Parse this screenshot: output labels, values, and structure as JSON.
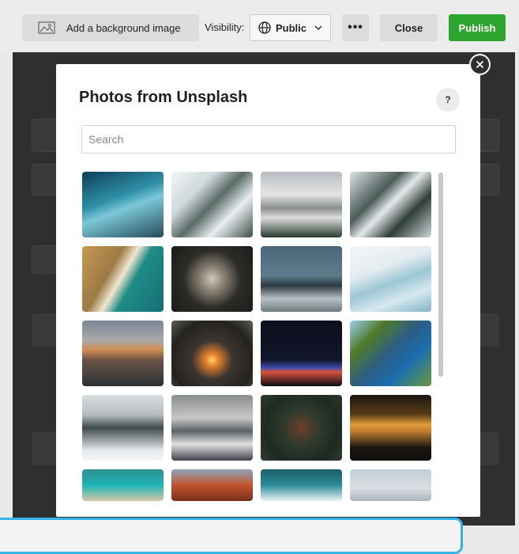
{
  "toolbar": {
    "bg_image_label": "Add a background image",
    "visibility_label": "Visibility:",
    "visibility_value": "Public",
    "more_label": "•••",
    "close_label": "Close",
    "publish_label": "Publish",
    "publish_color": "#2ba52e"
  },
  "modal": {
    "title": "Photos from Unsplash",
    "help_label": "?",
    "search_placeholder": "Search",
    "photos": [
      {
        "name": "ice-cave"
      },
      {
        "name": "snowy-ridge"
      },
      {
        "name": "mountain-valley"
      },
      {
        "name": "winding-road"
      },
      {
        "name": "coastline"
      },
      {
        "name": "castle"
      },
      {
        "name": "frozen-forest"
      },
      {
        "name": "glacier"
      },
      {
        "name": "half-dome"
      },
      {
        "name": "sea-arch"
      },
      {
        "name": "night-lights"
      },
      {
        "name": "alpine-lake"
      },
      {
        "name": "snowy-pines"
      },
      {
        "name": "misty-peaks"
      },
      {
        "name": "forest-aerial"
      },
      {
        "name": "sunset-sea"
      },
      {
        "name": "turquoise-shore"
      },
      {
        "name": "red-rocks"
      },
      {
        "name": "waves-aerial"
      },
      {
        "name": "foggy-lake"
      }
    ]
  },
  "icons": {
    "image": "image-icon",
    "globe": "globe-icon",
    "chevron": "chevron-down-icon",
    "close": "close-icon"
  }
}
